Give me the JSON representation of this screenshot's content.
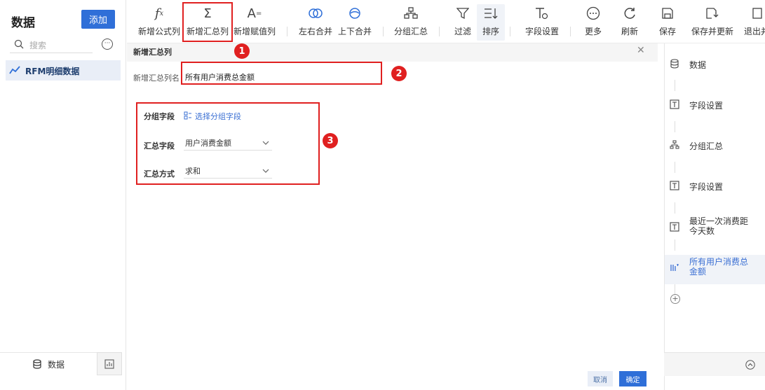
{
  "left": {
    "title": "数据",
    "add_label": "添加",
    "search_placeholder": "搜索",
    "dataset_name": "RFM明细数据",
    "tab_data_label": "数据"
  },
  "toolbar": {
    "items": [
      {
        "label": "新增公式列",
        "icon": "fx-icon"
      },
      {
        "label": "新增汇总列",
        "icon": "sigma-icon"
      },
      {
        "label": "新增赋值列",
        "icon": "assign-icon"
      },
      {
        "label": "左右合并",
        "icon": "merge-horizontal-icon"
      },
      {
        "label": "上下合并",
        "icon": "merge-vertical-icon"
      },
      {
        "label": "分组汇总",
        "icon": "group-summary-icon"
      },
      {
        "label": "过滤",
        "icon": "filter-icon"
      },
      {
        "label": "排序",
        "icon": "sort-icon"
      },
      {
        "label": "字段设置",
        "icon": "field-settings-icon"
      },
      {
        "label": "更多",
        "icon": "more-icon"
      },
      {
        "label": "刷新",
        "icon": "refresh-icon"
      },
      {
        "label": "保存",
        "icon": "save-icon"
      },
      {
        "label": "保存并更新",
        "icon": "save-update-icon"
      },
      {
        "label": "退出并",
        "icon": "exit-icon"
      }
    ]
  },
  "dialog": {
    "title": "新增汇总列",
    "name_label": "新增汇总列名",
    "name_value": "所有用户消费总金额",
    "group_label": "分组字段",
    "group_select": "选择分组字段",
    "sum_field_label": "汇总字段",
    "sum_field_value": "用户消费金额",
    "sum_method_label": "汇总方式",
    "sum_method_value": "求和",
    "cancel": "取消",
    "ok": "确定"
  },
  "steps": [
    {
      "label": "数据",
      "icon": "database-icon"
    },
    {
      "label": "字段设置",
      "icon": "field-settings-icon"
    },
    {
      "label": "分组汇总",
      "icon": "group-summary-icon"
    },
    {
      "label": "字段设置",
      "icon": "field-settings-icon"
    },
    {
      "label": "最近一次消费距今天数",
      "icon": "field-settings-icon"
    },
    {
      "label": "所有用户消费总金额",
      "icon": "summary-column-icon"
    }
  ],
  "annotations": {
    "b1": "1",
    "b2": "2",
    "b3": "3"
  }
}
